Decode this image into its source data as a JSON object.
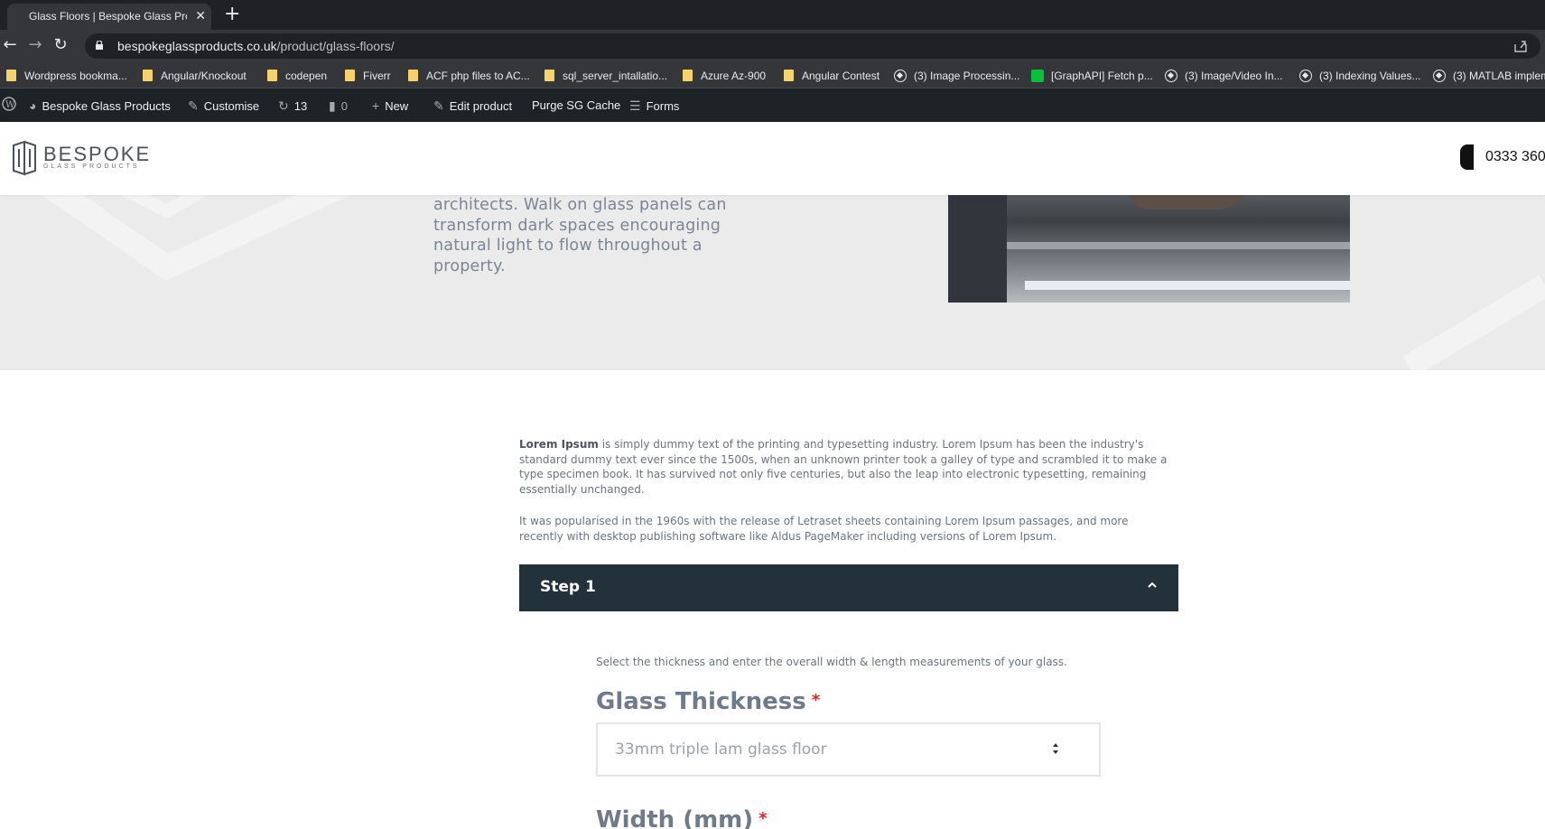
{
  "browser": {
    "tab_title": "Glass Floors | Bespoke Glass Prod",
    "tab_close": "✕",
    "new_tab": "+",
    "url_host": "bespokeglassproducts.co.uk",
    "url_path": "/product/glass-floors/",
    "bookmarks": [
      {
        "label": "Wordpress bookma...",
        "icon": "folder-icon"
      },
      {
        "label": "Angular/Knockout",
        "icon": "folder-icon"
      },
      {
        "label": "codepen",
        "icon": "folder-icon"
      },
      {
        "label": "Fiverr",
        "icon": "folder-icon"
      },
      {
        "label": "ACF php files to AC...",
        "icon": "folder-icon"
      },
      {
        "label": "sql_server_intallatio...",
        "icon": "folder-icon"
      },
      {
        "label": "Azure Az-900",
        "icon": "folder-icon"
      },
      {
        "label": "Angular Contest",
        "icon": "folder-icon"
      },
      {
        "label": "(3) Image Processin...",
        "icon": "site-icon"
      },
      {
        "label": "[GraphAPI] Fetch p...",
        "icon": "graphql-icon"
      },
      {
        "label": "(3) Image/Video In...",
        "icon": "site-icon"
      },
      {
        "label": "(3) Indexing Values...",
        "icon": "site-icon"
      },
      {
        "label": "(3) MATLAB implem",
        "icon": "site-icon"
      }
    ]
  },
  "adminbar": {
    "site_name": "Bespoke Glass Products",
    "customise": "Customise",
    "updates_count": "13",
    "comments_count": "0",
    "new": "New",
    "edit_product": "Edit product",
    "purge_cache": "Purge SG Cache",
    "forms": "Forms"
  },
  "header": {
    "logo_title": "BESPOKE",
    "logo_subtitle": "GLASS PRODUCTS",
    "phone": "0333 360"
  },
  "hero": {
    "text": "architects. Walk on glass panels can transform dark spaces encouraging natural light to flow throughout a property."
  },
  "content": {
    "intro_bold": "Lorem Ipsum",
    "intro_rest": " is simply dummy text of the printing and typesetting industry. Lorem Ipsum has been the industry's standard dummy text ever since the 1500s, when an unknown printer took a galley of type and scrambled it to make a type specimen book. It has survived not only five centuries, but also the leap into electronic typesetting, remaining essentially unchanged.",
    "intro_second": "It was popularised in the 1960s with the release of Letraset sheets containing Lorem Ipsum passages, and more recently with desktop publishing software like Aldus PageMaker including versions of Lorem Ipsum.",
    "step_title": "Step 1",
    "step_description": "Select the thickness and enter the overall width & length measurements of your glass.",
    "thickness_label": "Glass Thickness",
    "required_mark": "*",
    "thickness_value": "33mm triple lam glass floor",
    "width_label": "Width (mm)"
  },
  "colors": {
    "accordion_bg": "#22313a",
    "required": "#e52222",
    "admin_bar": "#1d2327"
  }
}
